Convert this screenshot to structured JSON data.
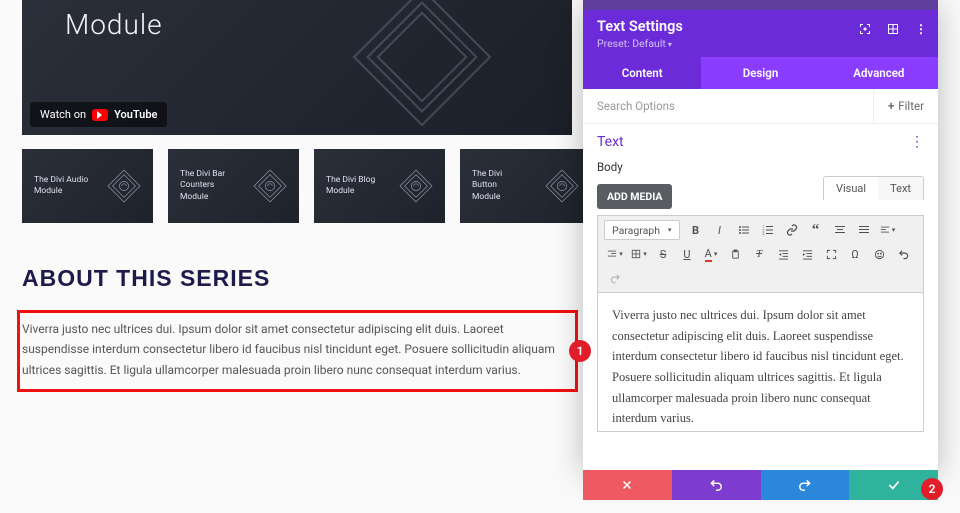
{
  "video": {
    "title": "Module",
    "watch_label": "Watch on",
    "watch_brand": "YouTube"
  },
  "thumbs": [
    {
      "label": "The Divi Audio Module"
    },
    {
      "label": "The Divi Bar Counters Module"
    },
    {
      "label": "The Divi Blog Module"
    },
    {
      "label": "The Divi Button Module"
    }
  ],
  "section_title": "ABOUT THIS SERIES",
  "body_text": "Viverra justo nec ultrices dui. Ipsum dolor sit amet consectetur adipiscing elit duis. Laoreet suspendisse interdum consectetur libero id faucibus nisl tincidunt eget. Posuere sollicitudin aliquam ultrices sagittis. Et ligula ullamcorper malesuada proin libero nunc consequat interdum varius.",
  "panel": {
    "title": "Text Settings",
    "preset": "Preset: Default",
    "tabs": {
      "content": "Content",
      "design": "Design",
      "advanced": "Advanced"
    },
    "search_placeholder": "Search Options",
    "filter_label": "Filter",
    "sec_title": "Text",
    "sec_sub": "Body",
    "add_media": "ADD MEDIA",
    "editor_tabs": {
      "visual": "Visual",
      "text": "Text"
    },
    "format_label": "Paragraph",
    "editor_text": "Viverra justo nec ultrices dui. Ipsum dolor sit amet consectetur adipiscing elit duis. Laoreet suspendisse interdum consectetur libero id faucibus nisl tincidunt eget. Posuere sollicitudin aliquam ultrices sagittis. Et ligula ullamcorper malesuada proin libero nunc consequat interdum varius."
  },
  "callouts": {
    "c1": "1",
    "c2": "2"
  }
}
